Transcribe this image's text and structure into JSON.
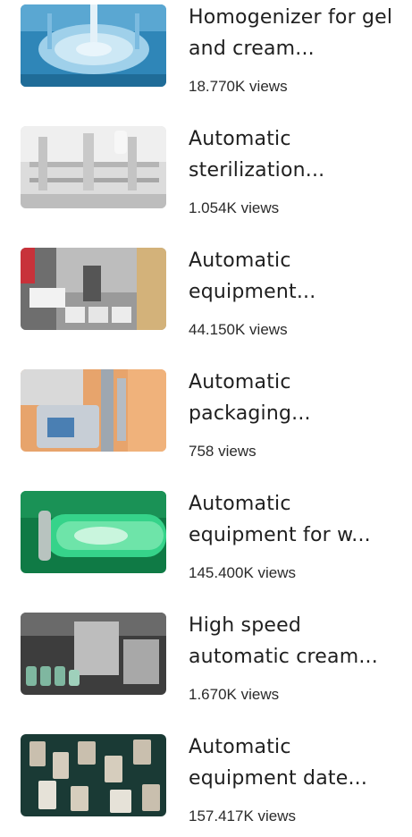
{
  "videos": [
    {
      "title": "Homogenizer for gel and cream...",
      "views": "18.770K views",
      "thumbnail_icon": "homogenizer-machine-thumbnail",
      "palette": {
        "bg": "#2f86b8",
        "mid": "#9fd0ea",
        "accent": "#e9f5fb"
      }
    },
    {
      "title": "Automatic sterilization...",
      "views": "1.054K views",
      "thumbnail_icon": "sterilization-line-thumbnail",
      "palette": {
        "bg": "#cfcfcf",
        "mid": "#efefef",
        "accent": "#a7a7a7"
      }
    },
    {
      "title": "Automatic equipment...",
      "views": "44.150K views",
      "thumbnail_icon": "boxing-machine-thumbnail",
      "palette": {
        "bg": "#8b8b8b",
        "mid": "#e6e6e6",
        "accent": "#c8323a"
      }
    },
    {
      "title": "Automatic packaging...",
      "views": "758 views",
      "thumbnail_icon": "packaging-machine-thumbnail",
      "palette": {
        "bg": "#e7a46c",
        "mid": "#d8dee4",
        "accent": "#4a7fb3"
      }
    },
    {
      "title": "Automatic equipment for w...",
      "views": "145.400K views",
      "thumbnail_icon": "mixing-tube-thumbnail",
      "palette": {
        "bg": "#0f7a45",
        "mid": "#36d38a",
        "accent": "#c9f5dd"
      }
    },
    {
      "title": "High speed automatic cream...",
      "views": "1.670K views",
      "thumbnail_icon": "tube-filling-machine-thumbnail",
      "palette": {
        "bg": "#3d3d3d",
        "mid": "#bdbdbd",
        "accent": "#7fb7a0"
      }
    },
    {
      "title": "Automatic equipment date...",
      "views": "157.417K views",
      "thumbnail_icon": "mould-parts-thumbnail",
      "palette": {
        "bg": "#1a3a35",
        "mid": "#c9bfae",
        "accent": "#e6e2d8"
      }
    }
  ]
}
